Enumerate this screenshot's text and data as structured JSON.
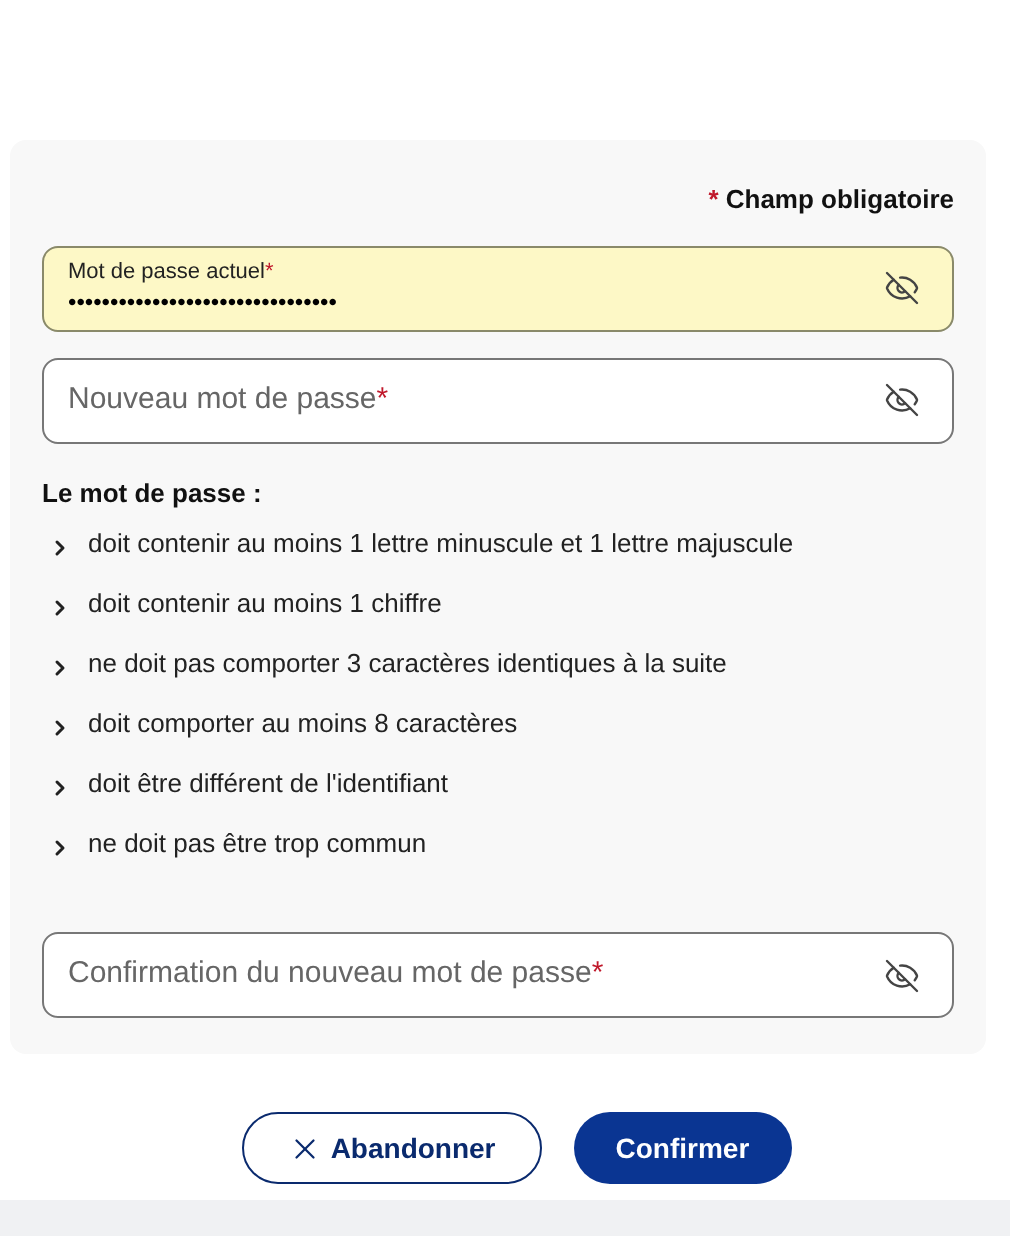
{
  "required_note": {
    "mark": "*",
    "text": "Champ obligatoire"
  },
  "fields": [
    {
      "label": "Mot de passe actuel",
      "required_mark": "*",
      "value": "••••••••••••••••••••••••••••••••",
      "autofilled": true
    },
    {
      "label": "Nouveau mot de passe",
      "required_mark": "*",
      "autofilled": false
    }
  ],
  "rules": {
    "title": "Le mot de passe :",
    "items": [
      "doit contenir au moins 1 lettre minuscule et 1 lettre majuscule",
      "doit contenir au moins 1 chiffre",
      "ne doit pas comporter 3 caractères identiques à la suite",
      "doit comporter au moins 8 caractères",
      "doit être différent de l'identifiant",
      "ne doit pas être trop commun"
    ]
  },
  "confirm_field": {
    "label": "Confirmation du nouveau mot de passe",
    "required_mark": "*",
    "autofilled": false
  },
  "buttons": [
    {
      "label": "Abandonner",
      "kind": "secondary"
    },
    {
      "label": "Confirmer",
      "kind": "primary"
    }
  ]
}
